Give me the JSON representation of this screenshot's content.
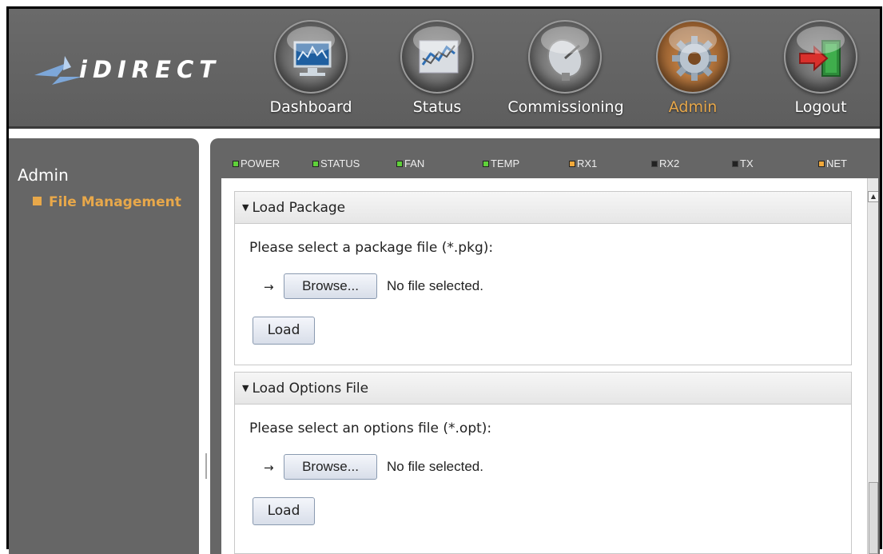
{
  "app": {
    "logo_text": "iDIRECT"
  },
  "nav": {
    "items": [
      {
        "label": "Dashboard",
        "icon": "monitor-icon"
      },
      {
        "label": "Status",
        "icon": "graph-icon"
      },
      {
        "label": "Commissioning",
        "icon": "satellite-dish-icon"
      },
      {
        "label": "Admin",
        "icon": "gear-icon",
        "active": true
      },
      {
        "label": "Logout",
        "icon": "exit-door-icon"
      }
    ]
  },
  "sidebar": {
    "title": "Admin",
    "items": [
      {
        "label": "File Management",
        "selected": true
      }
    ]
  },
  "status_leds": [
    {
      "label": "POWER",
      "color": "#5fd13a"
    },
    {
      "label": "STATUS",
      "color": "#5fd13a"
    },
    {
      "label": "FAN",
      "color": "#5fd13a"
    },
    {
      "label": "TEMP",
      "color": "#5fd13a"
    },
    {
      "label": "RX1",
      "color": "#f2a93b"
    },
    {
      "label": "RX2",
      "color": "#222222"
    },
    {
      "label": "TX",
      "color": "#222222"
    },
    {
      "label": "NET",
      "color": "#f2a93b"
    }
  ],
  "sections": {
    "load_package": {
      "title": "Load Package",
      "prompt": "Please select a package file (*.pkg):",
      "browse_label": "Browse...",
      "file_status": "No file selected.",
      "load_label": "Load"
    },
    "load_options": {
      "title": "Load Options File",
      "prompt": "Please select an options file (*.opt):",
      "browse_label": "Browse...",
      "file_status": "No file selected.",
      "load_label": "Load"
    }
  },
  "colors": {
    "accent": "#e8a84a",
    "chrome": "#666666"
  }
}
